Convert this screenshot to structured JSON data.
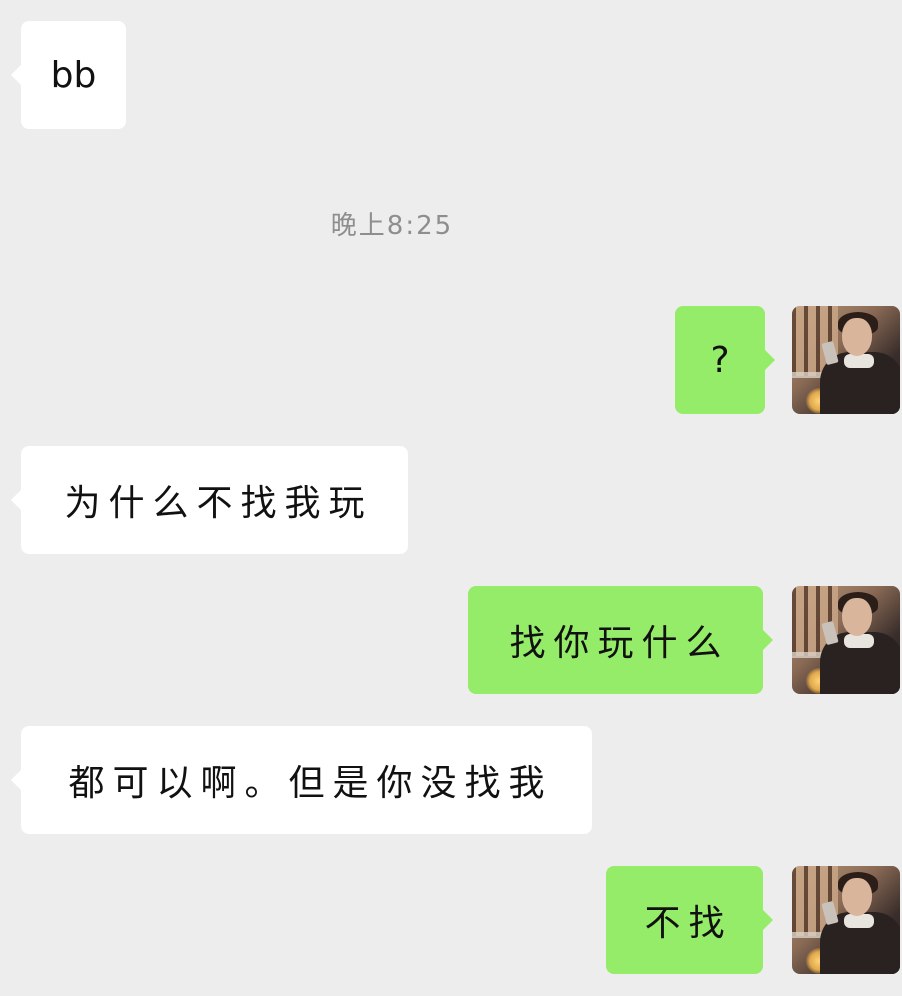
{
  "timestamp": "晚上8:25",
  "messages": [
    {
      "side": "in",
      "text": "bb"
    },
    {
      "side": "out",
      "text": "?"
    },
    {
      "side": "in",
      "text": "为什么不找我玩"
    },
    {
      "side": "out",
      "text": "找你玩什么"
    },
    {
      "side": "in",
      "text": "都可以啊。但是你没找我"
    },
    {
      "side": "out",
      "text": "不找"
    }
  ],
  "colors": {
    "background": "#ededed",
    "incoming_bubble": "#ffffff",
    "outgoing_bubble": "#95ec69",
    "timestamp": "#8e8e8e"
  },
  "icons": {
    "avatar": "user-avatar-photo"
  }
}
